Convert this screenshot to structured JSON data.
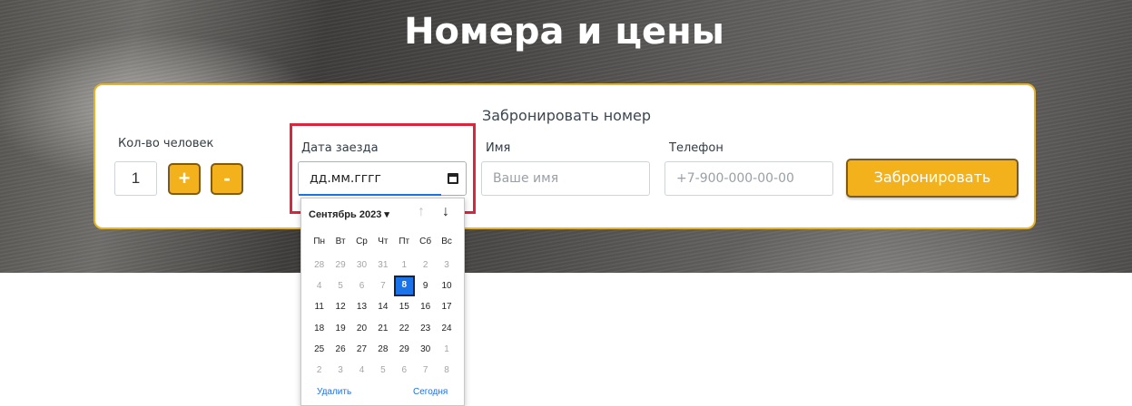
{
  "hero": {
    "title": "Номера и цены"
  },
  "booking": {
    "heading": "Забронировать номер",
    "guests": {
      "label": "Кол-во человек",
      "value": "1",
      "plus": "+",
      "minus": "-"
    },
    "checkin": {
      "label": "Дата заезда",
      "value": "дд.мм.гггг"
    },
    "name": {
      "label": "Имя",
      "placeholder": "Ваше имя"
    },
    "phone": {
      "label": "Телефон",
      "placeholder": "+7-900-000-00-00"
    },
    "submit": "Забронировать"
  },
  "calendar": {
    "month": "Сентябрь 2023 ▾",
    "up": "↑",
    "down": "↓",
    "weekdays": [
      "Пн",
      "Вт",
      "Ср",
      "Чт",
      "Пт",
      "Сб",
      "Вс"
    ],
    "weeks": [
      [
        {
          "d": "28",
          "m": true
        },
        {
          "d": "29",
          "m": true
        },
        {
          "d": "30",
          "m": true
        },
        {
          "d": "31",
          "m": true
        },
        {
          "d": "1",
          "m": true
        },
        {
          "d": "2",
          "m": true
        },
        {
          "d": "3",
          "m": true
        }
      ],
      [
        {
          "d": "4",
          "m": true
        },
        {
          "d": "5",
          "m": true
        },
        {
          "d": "6",
          "m": true
        },
        {
          "d": "7",
          "m": true
        },
        {
          "d": "8",
          "s": true
        },
        {
          "d": "9"
        },
        {
          "d": "10"
        }
      ],
      [
        {
          "d": "11"
        },
        {
          "d": "12"
        },
        {
          "d": "13"
        },
        {
          "d": "14"
        },
        {
          "d": "15"
        },
        {
          "d": "16"
        },
        {
          "d": "17"
        }
      ],
      [
        {
          "d": "18"
        },
        {
          "d": "19"
        },
        {
          "d": "20"
        },
        {
          "d": "21"
        },
        {
          "d": "22"
        },
        {
          "d": "23"
        },
        {
          "d": "24"
        }
      ],
      [
        {
          "d": "25"
        },
        {
          "d": "26"
        },
        {
          "d": "27"
        },
        {
          "d": "28"
        },
        {
          "d": "29"
        },
        {
          "d": "30"
        },
        {
          "d": "1",
          "m": true
        }
      ],
      [
        {
          "d": "2",
          "m": true
        },
        {
          "d": "3",
          "m": true
        },
        {
          "d": "4",
          "m": true
        },
        {
          "d": "5",
          "m": true
        },
        {
          "d": "6",
          "m": true
        },
        {
          "d": "7",
          "m": true
        },
        {
          "d": "8",
          "m": true
        }
      ]
    ],
    "clear": "Удалить",
    "today": "Сегодня"
  },
  "colors": {
    "accent": "#f3b21c",
    "highlight": "#d7263d",
    "link": "#1a73e8"
  }
}
